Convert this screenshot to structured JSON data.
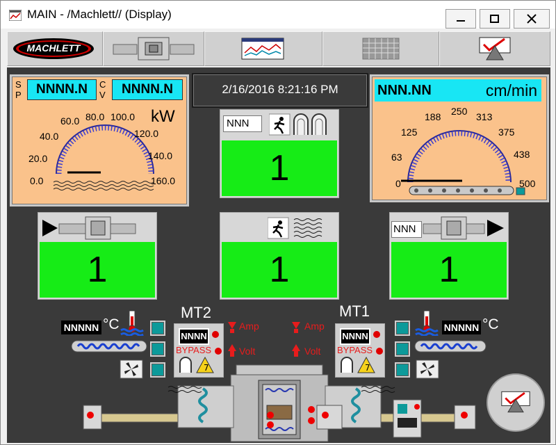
{
  "window": {
    "title": "MAIN - /Machlett// (Display)"
  },
  "toolbar": {
    "logo_text": "MACHLETT"
  },
  "power_panel": {
    "sp_label": "S P",
    "sp_value": "NNNN.N",
    "cv_label": "C V",
    "cv_value": "NNNN.N",
    "unit": "kW",
    "scale": [
      "0.0",
      "20.0",
      "40.0",
      "60.0",
      "80.0",
      "100.0",
      "120.0",
      "140.0",
      "160.0"
    ]
  },
  "datetime": "2/16/2016 8:21:16 PM",
  "speed_panel": {
    "value": "NNN.NN",
    "unit": "cm/min",
    "scale": [
      "0",
      "63",
      "125",
      "188",
      "250",
      "313",
      "375",
      "438",
      "500"
    ]
  },
  "center_top": {
    "tag": "NNN",
    "value": "1"
  },
  "left_mid": {
    "value": "1"
  },
  "center_mid": {
    "value": "1"
  },
  "right_mid": {
    "tag": "NNN",
    "value": "1"
  },
  "left_temp": {
    "value": "NNNNN",
    "unit": "°C"
  },
  "right_temp": {
    "value": "NNNNN",
    "unit": "°C"
  },
  "mt2": {
    "label": "MT2",
    "display": "NNNN",
    "status": "BYPASS",
    "amp_label": "Amp",
    "volt_label": "Volt"
  },
  "mt1": {
    "label": "MT1",
    "display": "NNNN",
    "status": "BYPASS",
    "amp_label": "Amp",
    "volt_label": "Volt"
  },
  "colors": {
    "background": "#3a3a3a",
    "gauge_panel": "#fac28b",
    "lcd": "#18e6f4",
    "status_green": "#16ec16",
    "alarm_red": "#e81c1c",
    "teal": "#0d9a9a"
  }
}
